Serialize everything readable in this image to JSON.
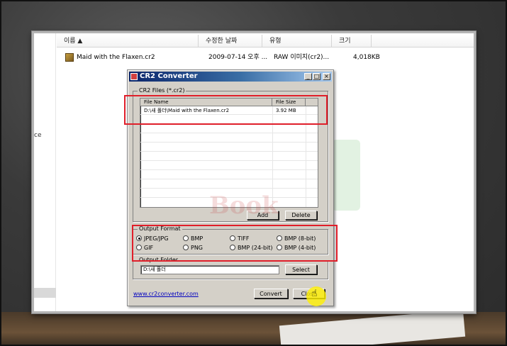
{
  "explorer": {
    "columns": [
      "이름 ▲",
      "수정한 날짜",
      "유형",
      "크기"
    ],
    "left_fragment": "ce",
    "file": {
      "name": "Maid with the Flaxen.cr2",
      "modified": "2009-07-14 오후 ...",
      "type": "RAW 이미지(cr2)...",
      "size": "4,018KB"
    }
  },
  "dialog": {
    "title": "CR2 Converter",
    "title_buttons": [
      "_",
      "□",
      "×"
    ],
    "files_group": "CR2 Files (*.cr2)",
    "list_headers": [
      "File Name",
      "File Size"
    ],
    "rows": [
      {
        "name": "D:\\새 폴더\\Maid with the Flaxen.cr2",
        "size": "3.92 MB"
      }
    ],
    "add_label": "Add",
    "delete_label": "Delete",
    "format_group": "Output Format",
    "formats": [
      {
        "label": "JPEG/JPG",
        "checked": true
      },
      {
        "label": "BMP",
        "checked": false
      },
      {
        "label": "TIFF",
        "checked": false
      },
      {
        "label": "BMP (8-bit)",
        "checked": false
      },
      {
        "label": "GIF",
        "checked": false
      },
      {
        "label": "PNG",
        "checked": false
      },
      {
        "label": "BMP (24-bit)",
        "checked": false
      },
      {
        "label": "BMP (4-bit)",
        "checked": false
      }
    ],
    "folder_group": "Output Folder",
    "folder_value": "D:\\새 폴더",
    "select_label": "Select",
    "url": "www.cr2converter.com",
    "convert_label": "Convert",
    "close_label": "Close"
  },
  "watermark": "Book",
  "colors": {
    "title_bar": "#0a246a",
    "highlight_box": "#e01f2a",
    "cursor_highlight": "#fff000"
  }
}
